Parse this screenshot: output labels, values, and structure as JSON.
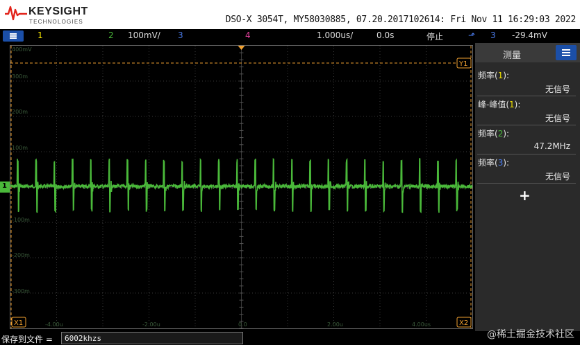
{
  "header": {
    "brand_name": "KEYSIGHT",
    "brand_sub": "TECHNOLOGIES",
    "instrument_info": "DSO-X 3054T, MY58030885, 07.20.2017102614: Fri Nov 11 16:29:03 2022"
  },
  "status": {
    "ch1": "1",
    "ch2": "2",
    "ch2_scale": "100mV/",
    "ch3": "3",
    "ch4": "4",
    "timebase": "1.000us/",
    "delay": "0.0s",
    "run_state": "停止",
    "trigger_source": "3",
    "trigger_level": "-29.4mV"
  },
  "colors": {
    "ch1": "#f0e000",
    "ch2": "#4ab93a",
    "ch3": "#4a7ae8",
    "ch4": "#e0409a",
    "accent": "#1b4fa8",
    "trigger": "#f0a030"
  },
  "graticule": {
    "v_labels": [
      "400mV",
      "300m",
      "200m",
      "100m",
      "-100m",
      "-200m",
      "-300m"
    ],
    "t_labels": [
      "-4.00u",
      "-2.00u",
      "0.0",
      "2.00u",
      "4.00us"
    ],
    "ch1_marker": "1",
    "cursor_x1": "X1",
    "cursor_x2": "X2",
    "cursor_y1": "Y1"
  },
  "measurements": {
    "title": "测量",
    "items": [
      {
        "name": "频率",
        "ch": "1",
        "value": "无信号"
      },
      {
        "name": "峰-峰值",
        "ch": "1",
        "value": "无信号"
      },
      {
        "name": "频率",
        "ch": "2",
        "value": "47.2MHz"
      },
      {
        "name": "频率",
        "ch": "3",
        "value": "无信号"
      }
    ],
    "add": "+"
  },
  "bottom": {
    "save_label": "保存到文件 =",
    "save_value": "6002khzs"
  },
  "watermark": "@稀土掘金技术社区"
}
